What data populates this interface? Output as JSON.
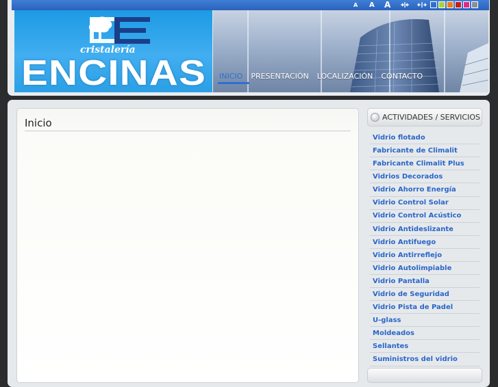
{
  "toolbar": {
    "font_small": "A",
    "font_medium": "A",
    "font_large": "A",
    "width_narrow_icon": "arrows-inward-icon",
    "width_wide_icon": "arrows-outward-icon",
    "color_swatches": [
      "#2f6fd0",
      "#a8d43a",
      "#f07a16",
      "#c41e1e",
      "#e02a8a",
      "#8c8f94"
    ]
  },
  "logo": {
    "sub": "cristalería",
    "main": "ENCINAS"
  },
  "nav": {
    "items": [
      "INICIO",
      "PRESENTACIÓN",
      "LOCALIZACIÓN",
      "CONTACTO"
    ],
    "active": "INICIO"
  },
  "content": {
    "title": "Inicio"
  },
  "sidebar": {
    "title": "ACTIVIDADES / SERVICIOS",
    "items": [
      "Vidrio flotado",
      "Fabricante de Climalit",
      "Fabricante Climalit Plus",
      "Vidrios Decorados",
      "Vidrio Ahorro Energía",
      "Vidrio Control Solar",
      "Vidrio Control Acústico",
      "Vidrio Antideslizante",
      "Vidrio Antifuego",
      "Vidrio Antirreflejo",
      "Vidrio Autolimpiable",
      "Vidrio Pantalla",
      "Vidrio de Seguridad",
      "Vidrio Pista de Padel",
      "U-glass",
      "Moldeados",
      "Sellantes",
      "Suministros del vidrio"
    ]
  },
  "colors": {
    "accent": "#2f6fd0",
    "link": "#2a66c8"
  }
}
